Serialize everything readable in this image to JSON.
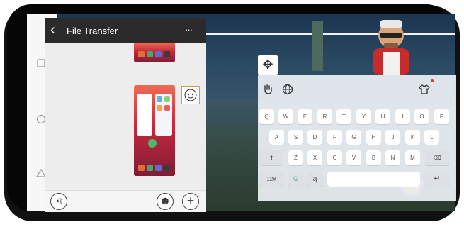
{
  "nav": {
    "recents_icon": "square-icon",
    "home_icon": "circle-icon",
    "back_icon": "triangle-icon"
  },
  "chat": {
    "title": "File Transfer",
    "back_glyph": "‹",
    "more_glyph": "···"
  },
  "input": {
    "voice_glyph": "◖))",
    "emoji_glyph": "☻",
    "plus_glyph": "+"
  },
  "keyboard": {
    "drag_glyph": "✥",
    "row1": [
      "Q",
      "W",
      "E",
      "R",
      "T",
      "Y",
      "U",
      "I",
      "O",
      "P"
    ],
    "row2": [
      "A",
      "S",
      "D",
      "F",
      "G",
      "H",
      "J",
      "K",
      "L"
    ],
    "row3": [
      "⬆",
      "Z",
      "X",
      "C",
      "V",
      "B",
      "N",
      "M",
      "⌫"
    ],
    "row4": {
      "sym": "12#",
      "emoji": "☺",
      "lang": "ą",
      "enter": "↵"
    },
    "toolbar": {
      "handwriting_icon": "hand-icon",
      "globe_icon": "globe-icon",
      "skin_icon": "shirt-icon"
    }
  },
  "colors": {
    "header": "#2b2b2b",
    "notify_dot": "#e53935"
  }
}
